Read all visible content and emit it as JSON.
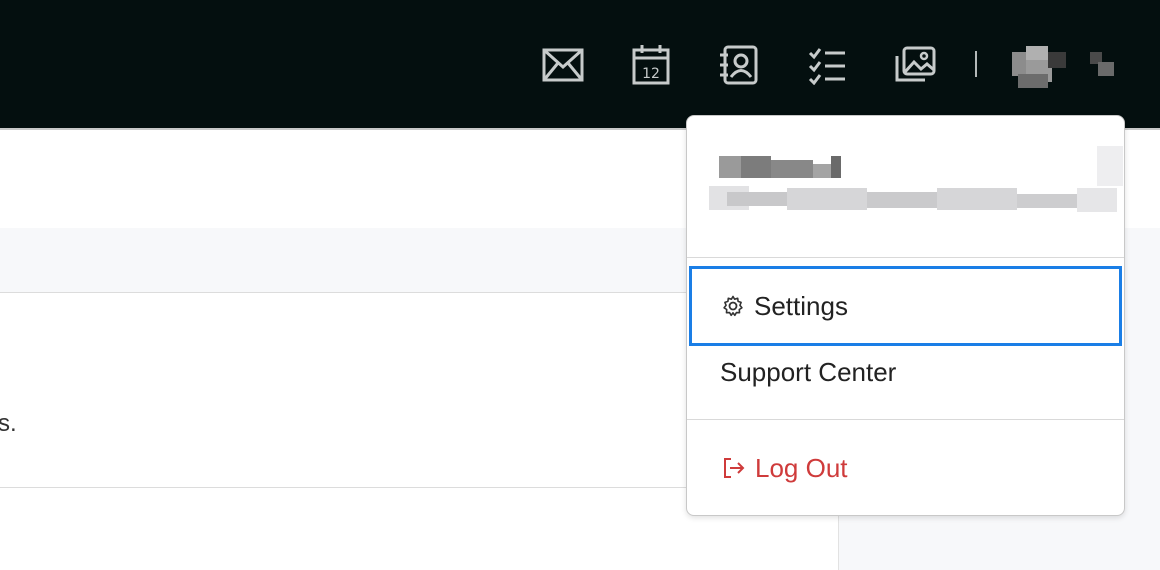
{
  "topbar": {
    "icons": [
      {
        "name": "mail-icon"
      },
      {
        "name": "calendar-icon",
        "badge": "12"
      },
      {
        "name": "contacts-icon"
      },
      {
        "name": "tasks-icon"
      },
      {
        "name": "photos-icon"
      }
    ],
    "background": "#040f0f"
  },
  "content": {
    "fragment_text": "s."
  },
  "dropdown": {
    "menu": {
      "settings_label": "Settings",
      "support_label": "Support Center",
      "logout_label": "Log Out"
    },
    "colors": {
      "focus_border": "#1a7ee6",
      "logout_text": "#cf3b3b"
    }
  }
}
